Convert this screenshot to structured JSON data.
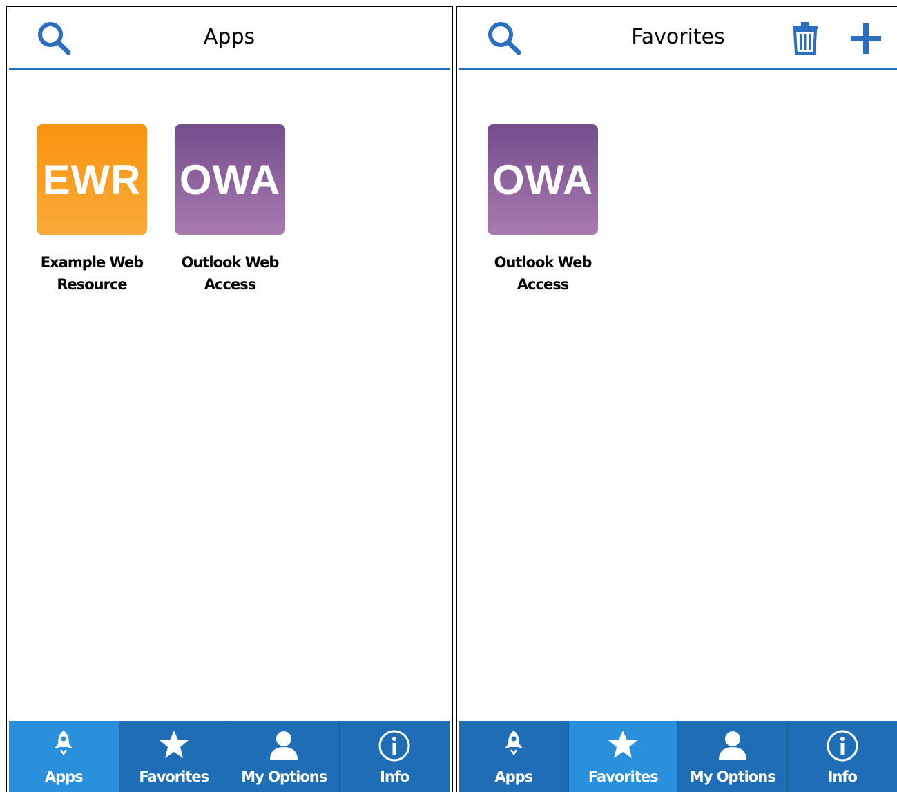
{
  "colors": {
    "accent": "#2a6ebf",
    "tabbar": "#1f6db5",
    "tab_active": "#2a90dc",
    "ewr": "#f7930e",
    "owa": "#8a5f9e"
  },
  "left": {
    "title": "Apps",
    "header_icons": [
      "search-icon"
    ],
    "tiles": [
      {
        "abbr": "EWR",
        "label_line1": "Example Web",
        "label_line2": "Resource"
      },
      {
        "abbr": "OWA",
        "label_line1": "Outlook Web",
        "label_line2": "Access"
      }
    ],
    "active_tab": "Apps"
  },
  "right": {
    "title": "Favorites",
    "header_icons": [
      "search-icon",
      "trash-icon",
      "plus-icon"
    ],
    "tiles": [
      {
        "abbr": "OWA",
        "label_line1": "Outlook Web",
        "label_line2": "Access"
      }
    ],
    "active_tab": "Favorites"
  },
  "tabs": [
    {
      "label": "Apps",
      "icon": "rocket-icon"
    },
    {
      "label": "Favorites",
      "icon": "star-icon"
    },
    {
      "label": "My Options",
      "icon": "user-icon"
    },
    {
      "label": "Info",
      "icon": "info-icon"
    }
  ]
}
